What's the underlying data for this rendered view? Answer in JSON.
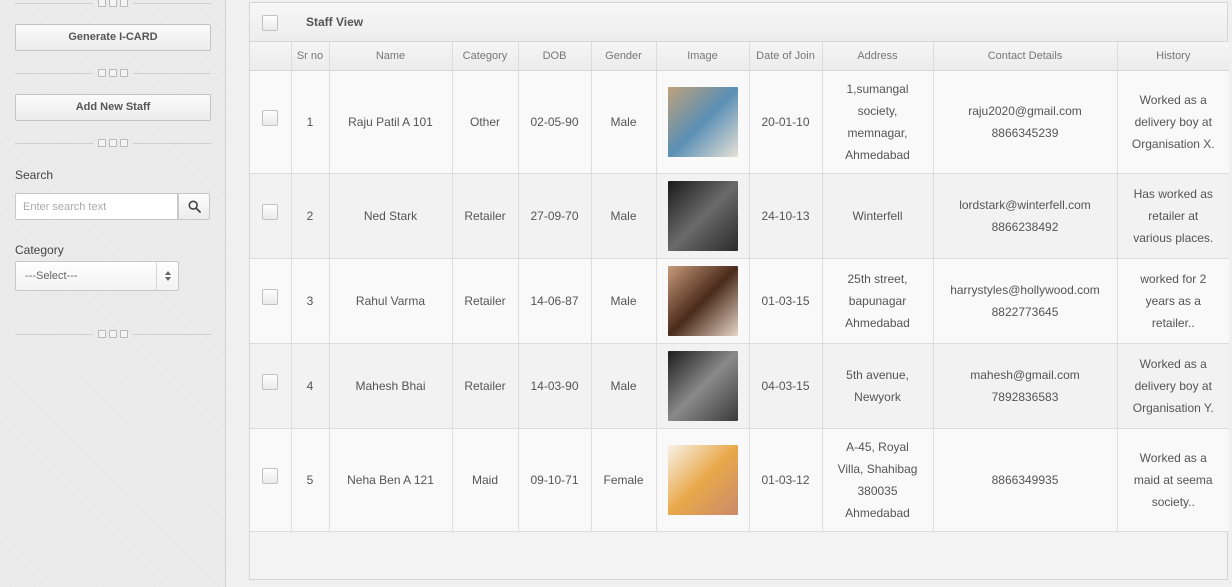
{
  "sidebar": {
    "generate_icard_label": "Generate I-CARD",
    "add_staff_label": "Add New Staff",
    "search_label": "Search",
    "search_placeholder": "Enter search text",
    "category_label": "Category",
    "category_selected": "---Select---"
  },
  "panel": {
    "title": "Staff View",
    "columns": [
      "Sr no",
      "Name",
      "Category",
      "DOB",
      "Gender",
      "Image",
      "Date of Join",
      "Address",
      "Contact Details",
      "History"
    ]
  },
  "rows": [
    {
      "sr": "1",
      "name": "Raju Patil A 101",
      "category": "Other",
      "dob": "02-05-90",
      "gender": "Male",
      "image": "person-photo",
      "doj": "20-01-10",
      "address": [
        "1,sumangal",
        "society,",
        "memnagar,",
        "Ahmedabad"
      ],
      "contact": [
        "raju2020@gmail.com",
        "8866345239"
      ],
      "history": [
        "Worked as a",
        "delivery boy at",
        "Organisation X."
      ]
    },
    {
      "sr": "2",
      "name": "Ned Stark",
      "category": "Retailer",
      "dob": "27-09-70",
      "gender": "Male",
      "image": "person-photo",
      "doj": "24-10-13",
      "address": [
        "Winterfell"
      ],
      "contact": [
        "lordstark@winterfell.com",
        "8866238492"
      ],
      "history": [
        "Has worked as",
        "retailer at",
        "various places."
      ]
    },
    {
      "sr": "3",
      "name": "Rahul Varma",
      "category": "Retailer",
      "dob": "14-06-87",
      "gender": "Male",
      "image": "person-photo",
      "doj": "01-03-15",
      "address": [
        "25th street,",
        "bapunagar",
        "Ahmedabad"
      ],
      "contact": [
        "harrystyles@hollywood.com",
        "8822773645"
      ],
      "history": [
        "worked for 2",
        "years as a",
        "retailer.."
      ]
    },
    {
      "sr": "4",
      "name": "Mahesh Bhai",
      "category": "Retailer",
      "dob": "14-03-90",
      "gender": "Male",
      "image": "person-photo",
      "doj": "04-03-15",
      "address": [
        "5th avenue,",
        "Newyork"
      ],
      "contact": [
        "mahesh@gmail.com",
        "7892836583"
      ],
      "history": [
        "Worked as a",
        "delivery boy at",
        "Organisation Y."
      ]
    },
    {
      "sr": "5",
      "name": "Neha Ben A 121",
      "category": "Maid",
      "dob": "09-10-71",
      "gender": "Female",
      "image": "person-photo",
      "doj": "01-03-12",
      "address": [
        "A-45, Royal",
        "Villa, Shahibag",
        "380035",
        "Ahmedabad"
      ],
      "contact": [
        "8866349935"
      ],
      "history": [
        "Worked as a",
        "maid at seema",
        "society.."
      ]
    }
  ],
  "colors": {
    "photo1": [
      "#bfa27a",
      "#5a8fb5",
      "#e6e1d6"
    ],
    "photo2": [
      "#1a1a1a",
      "#6a6a6a",
      "#2b2b2b"
    ],
    "photo3": [
      "#c89a7a",
      "#4a2a1a",
      "#e8d5c5"
    ],
    "photo4": [
      "#1c1c1c",
      "#8a8a8a",
      "#3a3a3a"
    ],
    "photo5": [
      "#f7f1e8",
      "#e9a84a",
      "#c98a6a"
    ]
  }
}
